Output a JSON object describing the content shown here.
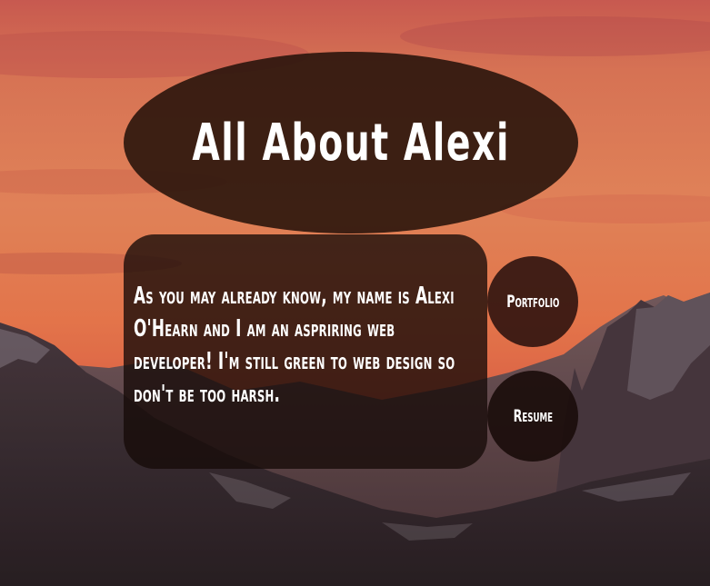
{
  "header": {
    "title": "All About Alexi"
  },
  "about": {
    "text": "As you may already know, my name is Alexi O'Hearn and I am an aspriring web developer! I'm still green to web design so don't be too harsh."
  },
  "nav": {
    "portfolio_label": "Portfolio",
    "resume_label": "Resume"
  },
  "colors": {
    "title_oval": "#26120a",
    "text": "#ffffff",
    "sky_top": "#d86a52",
    "sky_glow": "#f2804a",
    "mountain": "#3a2a2c"
  }
}
